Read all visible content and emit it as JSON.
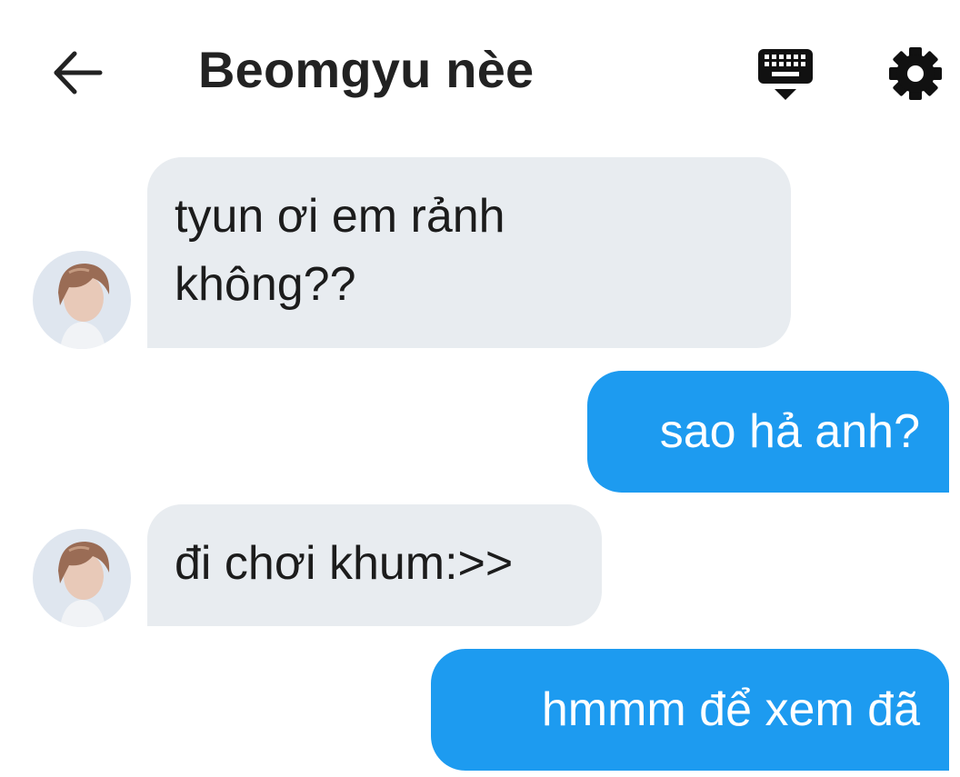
{
  "header": {
    "back_icon": "arrow-left-icon",
    "title": "Beomgyu nèe",
    "keyboard_icon": "keyboard-hide-icon",
    "settings_icon": "gear-icon"
  },
  "messages": [
    {
      "sender": "them",
      "lines": [
        "tyun ơi em rảnh",
        "không??"
      ],
      "avatar": "contact-avatar"
    },
    {
      "sender": "me",
      "lines": [
        "sao hả anh?"
      ]
    },
    {
      "sender": "them",
      "lines": [
        "đi chơi khum:>>"
      ],
      "avatar": "contact-avatar"
    },
    {
      "sender": "me",
      "lines": [
        "hmmm để xem đã"
      ]
    }
  ],
  "colors": {
    "incoming_bubble": "#e8ecf0",
    "outgoing_bubble": "#1d9bf0",
    "title_text": "#222222"
  }
}
